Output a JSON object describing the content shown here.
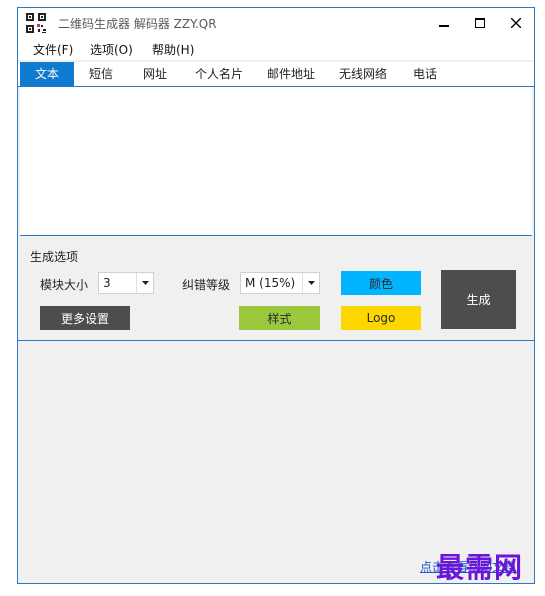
{
  "window": {
    "title": "二维码生成器 解码器 ZZY.QR",
    "minimize": "minimize",
    "maximize": "maximize",
    "close": "close"
  },
  "menu": [
    "文件(F)",
    "选项(O)",
    "帮助(H)"
  ],
  "tabs": [
    {
      "label": "文本",
      "active": true
    },
    {
      "label": "短信",
      "active": false
    },
    {
      "label": "网址",
      "active": false
    },
    {
      "label": "个人名片",
      "active": false
    },
    {
      "label": "邮件地址",
      "active": false
    },
    {
      "label": "无线网络",
      "active": false
    },
    {
      "label": "电话",
      "active": false
    }
  ],
  "options": {
    "section_title": "生成选项",
    "module_size_label": "模块大小",
    "module_size_value": "3",
    "ecc_label": "纠错等级",
    "ecc_value": "M (15%)",
    "color_button": "颜色",
    "style_button": "样式",
    "logo_button": "Logo",
    "more_settings_button": "更多设置",
    "generate_button": "生成"
  },
  "footer": {
    "link_text": "点击查看帮助文档",
    "watermark": "最需网"
  },
  "colors": {
    "accent": "#0f7bd0",
    "color_btn": "#00b4ff",
    "style_btn": "#9bc83c",
    "logo_btn": "#ffd700",
    "dark_btn": "#4d4d4d",
    "watermark": "#6a16d9"
  }
}
